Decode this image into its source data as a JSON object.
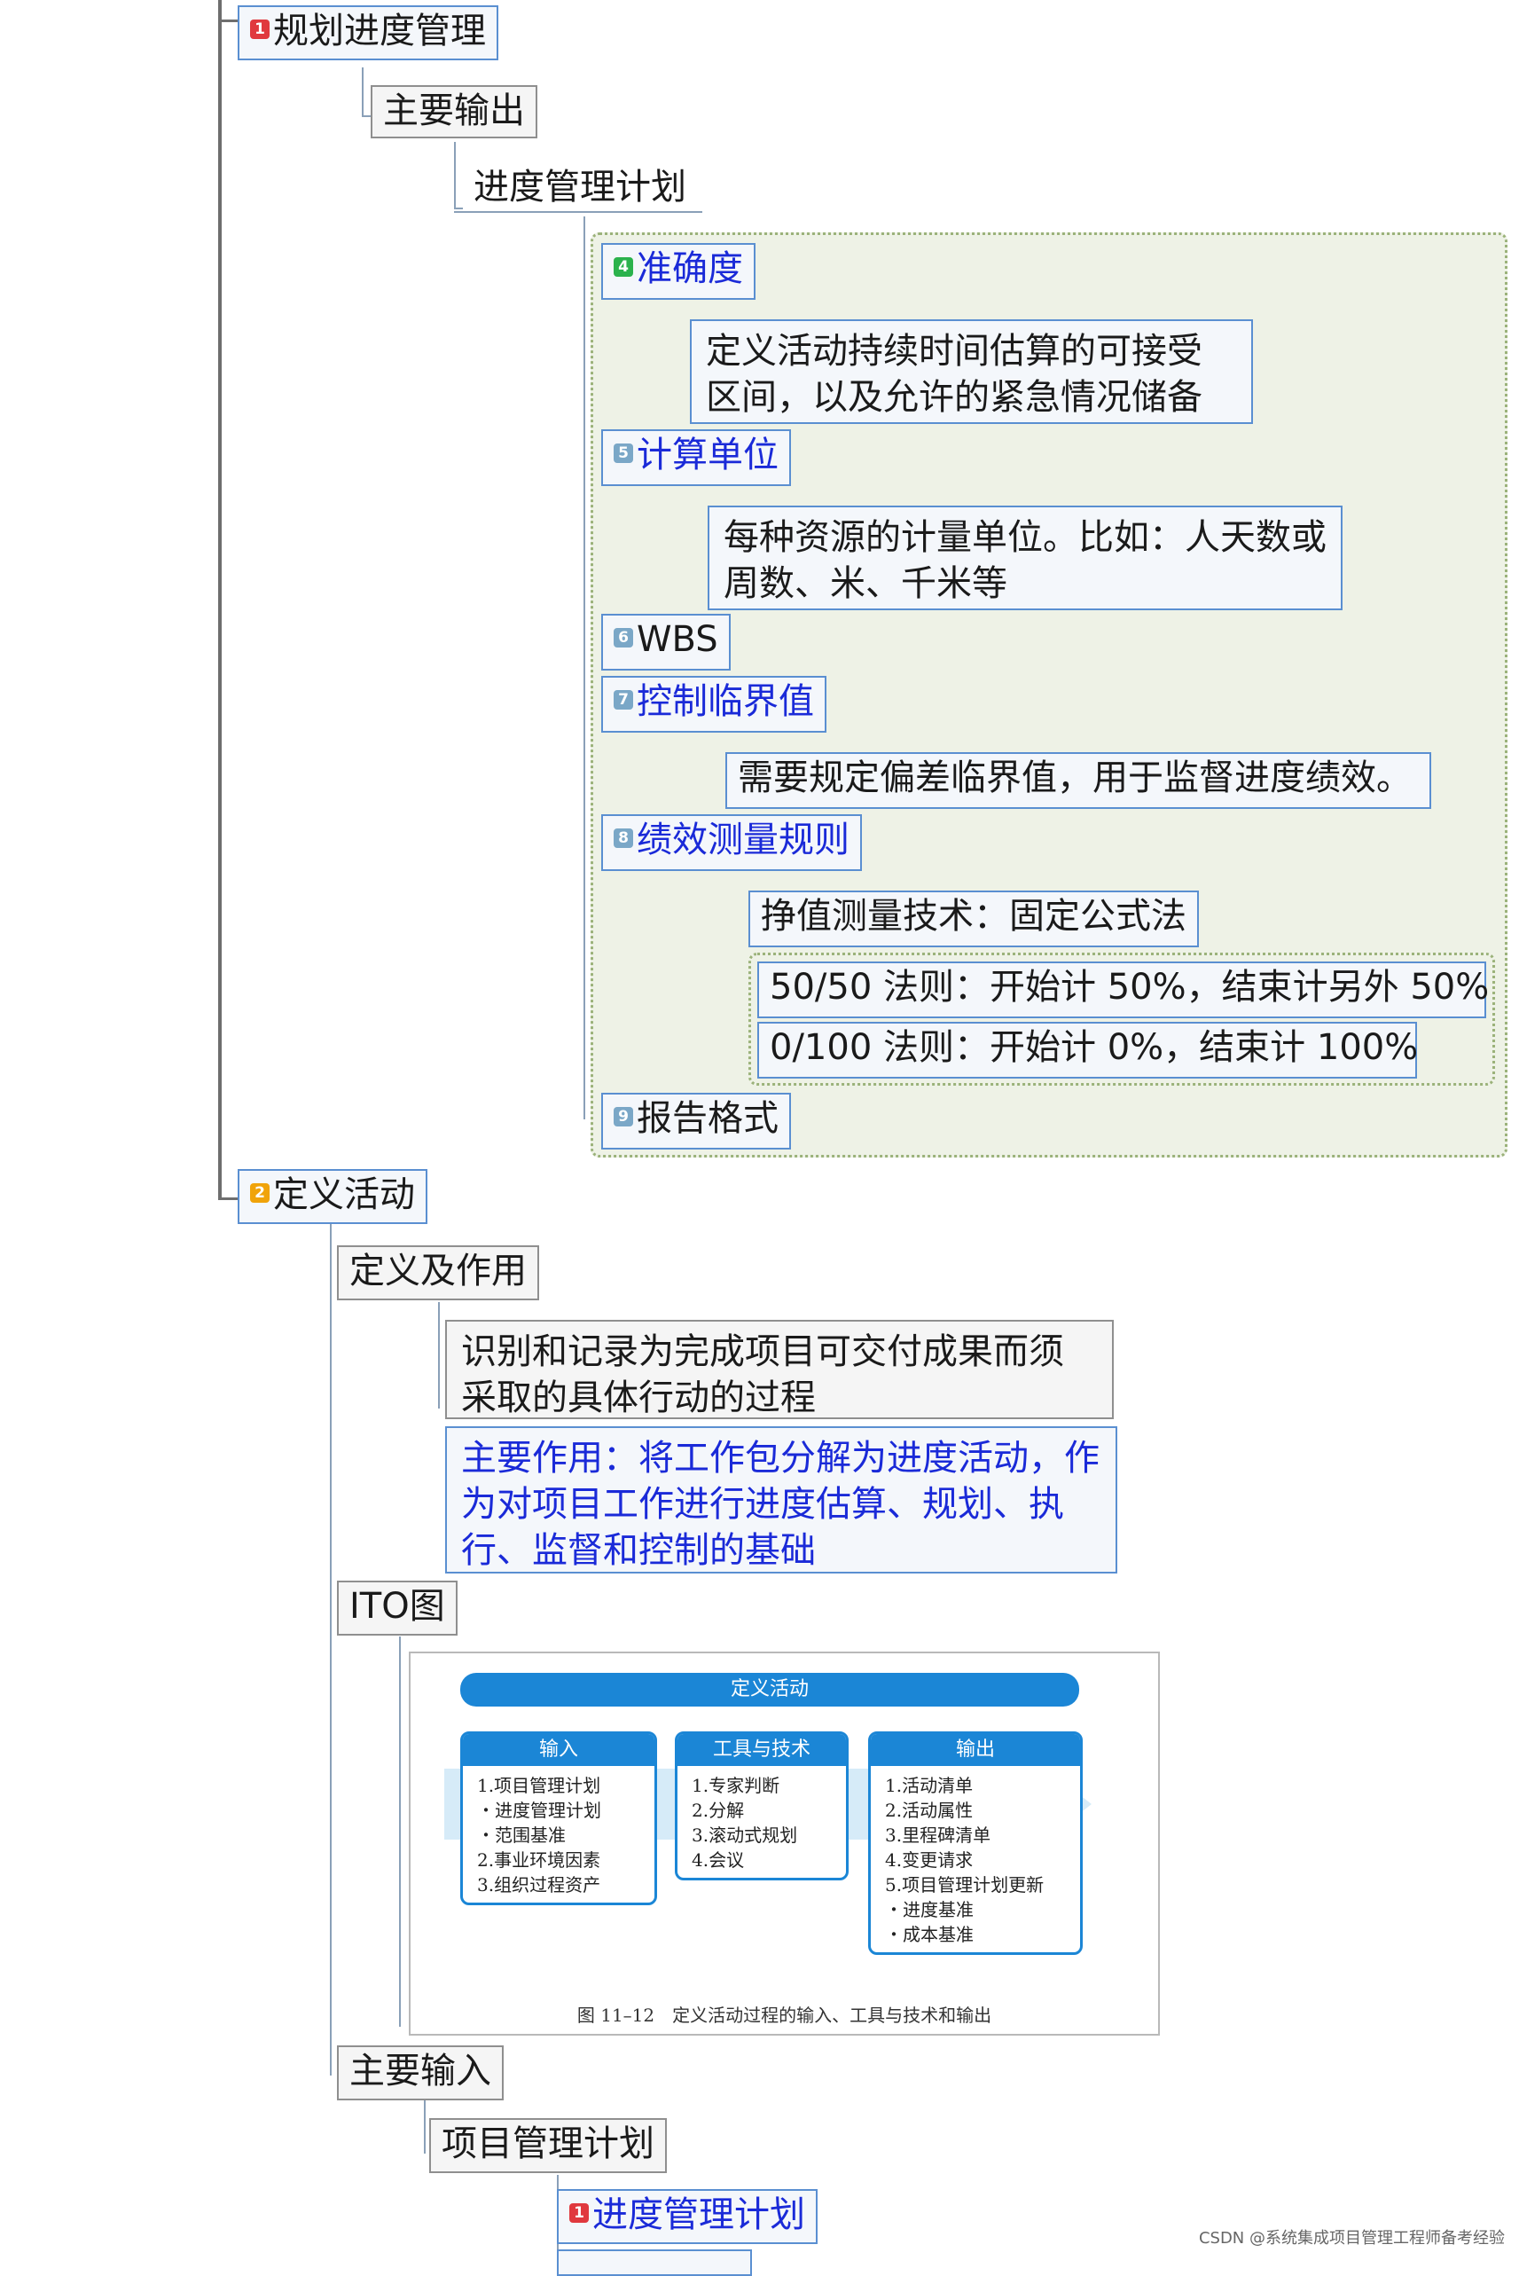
{
  "nodes": {
    "plan_schedule_mgmt": "规划进度管理",
    "main_output": "主要输出",
    "schedule_mgmt_plan": "进度管理计划",
    "accuracy": "准确度",
    "accuracy_desc": "定义活动持续时间估算的可接受区间，以及允许的紧急情况储备",
    "unit": "计算单位",
    "unit_desc": "每种资源的计量单位。比如：人天数或周数、米、千米等",
    "wbs": "WBS",
    "control_threshold": "控制临界值",
    "control_threshold_desc": "需要规定偏差临界值，用于监督进度绩效。",
    "performance_rules": "绩效测量规则",
    "ev_technique": "挣值测量技术：固定公式法",
    "rule_5050": "50/50 法则：开始计 50%，结束计另外 50%",
    "rule_0100": "0/100 法则：开始计 0%，结束计 100%",
    "report_format": "报告格式",
    "define_activities": "定义活动",
    "definition_role": "定义及作用",
    "definition_desc": "识别和记录为完成项目可交付成果而须采取的具体行动的过程",
    "main_role_desc": "主要作用：将工作包分解为进度活动，作为对项目工作进行进度估算、规划、执行、监督和控制的基础",
    "ito_chart": "ITO图",
    "main_input": "主要输入",
    "project_mgmt_plan": "项目管理计划",
    "schedule_mgmt_plan_2": "进度管理计划"
  },
  "badges": {
    "b1": {
      "text": "1",
      "color": "#e0393e"
    },
    "b2": {
      "text": "2",
      "color": "#f0a30a"
    },
    "b4": {
      "text": "4",
      "color": "#2bb24c"
    },
    "b5": {
      "text": "5",
      "color": "#7aa7c7"
    },
    "b6": {
      "text": "6",
      "color": "#7aa7c7"
    },
    "b7": {
      "text": "7",
      "color": "#7aa7c7"
    },
    "b8": {
      "text": "8",
      "color": "#7aa7c7"
    },
    "b9": {
      "text": "9",
      "color": "#7aa7c7"
    },
    "b1b": {
      "text": "1",
      "color": "#e0393e"
    }
  },
  "ito": {
    "header": "定义活动",
    "input_title": "输入",
    "input_items": [
      "1.项目管理计划",
      "・进度管理计划",
      "・范围基准",
      "2.事业环境因素",
      "3.组织过程资产"
    ],
    "tools_title": "工具与技术",
    "tools_items": [
      "1.专家判断",
      "2.分解",
      "3.滚动式规划",
      "4.会议"
    ],
    "output_title": "输出",
    "output_items": [
      "1.活动清单",
      "2.活动属性",
      "3.里程碑清单",
      "4.变更请求",
      "5.项目管理计划更新",
      "・进度基准",
      "・成本基准"
    ],
    "caption": "图 11–12　定义活动过程的输入、工具与技术和输出"
  },
  "watermark": "CSDN @系统集成项目管理工程师备考经验",
  "colors": {
    "blue_text": "#1a2ad8",
    "blue_border": "#5a8fd1",
    "group_bg": "#eef2e6",
    "ito_blue": "#1b86d6"
  }
}
